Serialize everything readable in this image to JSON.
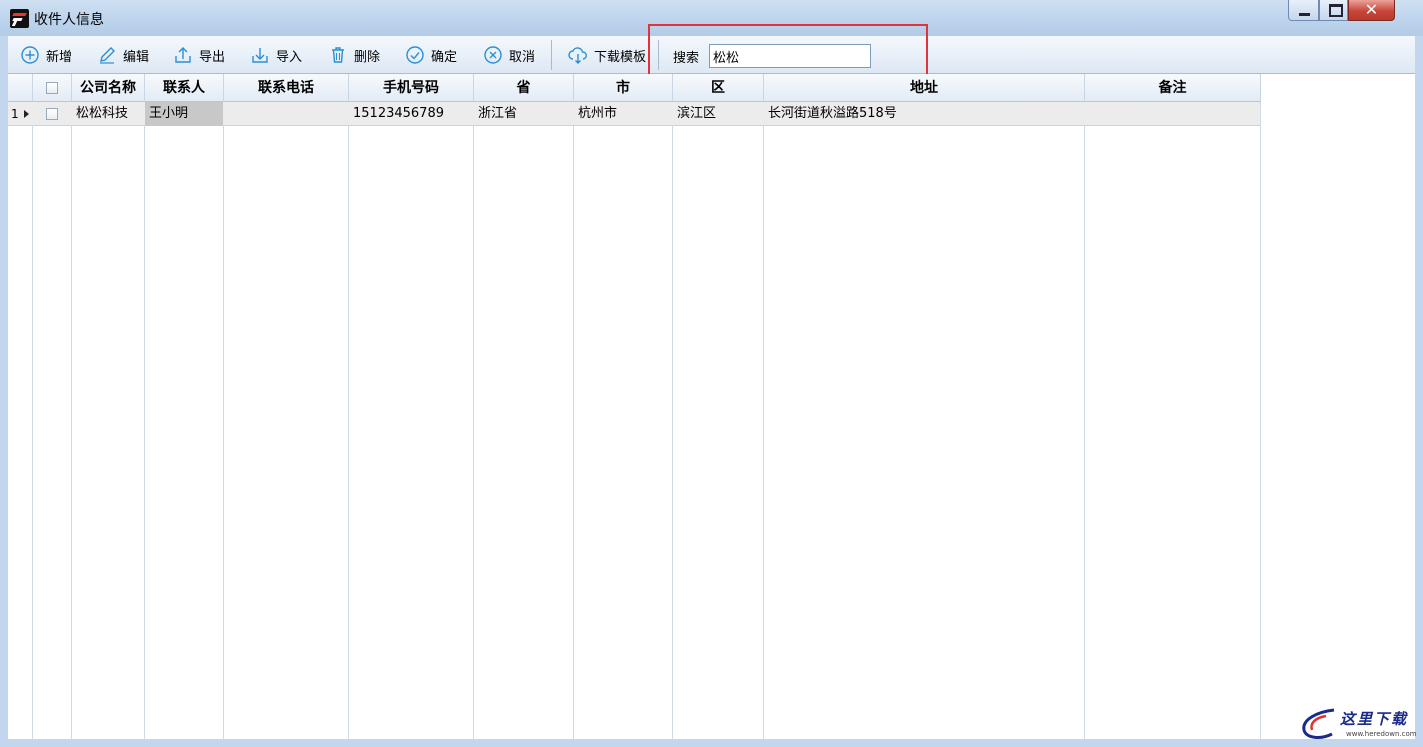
{
  "window": {
    "title": "收件人信息",
    "close_glyph": "✕"
  },
  "toolbar": {
    "buttons": [
      {
        "label": "新增",
        "icon": "plus-circle-icon"
      },
      {
        "label": "编辑",
        "icon": "pencil-icon"
      },
      {
        "label": "导出",
        "icon": "upload-icon"
      },
      {
        "label": "导入",
        "icon": "download-icon"
      },
      {
        "label": "删除",
        "icon": "trash-icon"
      },
      {
        "label": "确定",
        "icon": "check-circle-icon"
      },
      {
        "label": "取消",
        "icon": "x-circle-icon"
      },
      {
        "label": "下载模板",
        "icon": "cloud-download-icon"
      }
    ],
    "search_label": "搜索",
    "search_value": "松松"
  },
  "grid": {
    "columns": [
      "公司名称",
      "联系人",
      "联系电话",
      "手机号码",
      "省",
      "市",
      "区",
      "地址",
      "备注"
    ],
    "rows": [
      {
        "num": "1",
        "company": "松松科技",
        "contact": "王小明",
        "phone": "",
        "mobile": "15123456789",
        "province": "浙江省",
        "city": "杭州市",
        "district": "滨江区",
        "address": "长河街道秋溢路518号",
        "note": ""
      }
    ]
  },
  "watermark": {
    "text": "这里下载",
    "url": "www.heredown.com"
  },
  "colors": {
    "accent_icon": "#2b8fd6",
    "highlight": "#e0343c",
    "titlebar": "#bcd3ec"
  }
}
